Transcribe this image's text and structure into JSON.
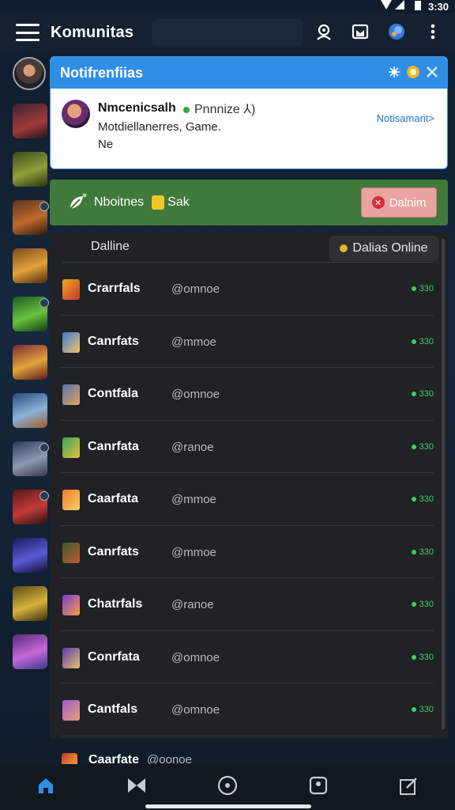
{
  "status_bar": {
    "time": "3:30"
  },
  "topbar": {
    "title": "Komunitas",
    "icons": [
      "menu-icon",
      "person-search-icon",
      "store-icon",
      "globe-icon",
      "more-vert-icon"
    ]
  },
  "notification": {
    "header_title": "Notifrenfiias",
    "sender_name": "Nmcenicsalh",
    "presence": "Pnnnize ⅄)",
    "line2": "Motdiellanerres, Game.",
    "line3": "Ne",
    "link": "Notisamarit>"
  },
  "friend_request": {
    "label": "Nboitnes",
    "label2": "Sak",
    "deny_label": "Dalnim"
  },
  "panel": {
    "title": "Dalline",
    "online_button": "Dalias Online"
  },
  "rows": [
    {
      "name": "Crarrfals",
      "handle": "@omnoe",
      "status": "330"
    },
    {
      "name": "Canrfats",
      "handle": "@mmoe",
      "status": "330"
    },
    {
      "name": "Contfala",
      "handle": "@omnoe",
      "status": "330"
    },
    {
      "name": "Canrfata",
      "handle": "@ranoe",
      "status": "330"
    },
    {
      "name": "Caarfata",
      "handle": "@mmoe",
      "status": "330"
    },
    {
      "name": "Canrfats",
      "handle": "@mmoe",
      "status": "330"
    },
    {
      "name": "Chatrfals",
      "handle": "@ranoe",
      "status": "330"
    },
    {
      "name": "Conrfata",
      "handle": "@omnoe",
      "status": "330"
    },
    {
      "name": "Cantfals",
      "handle": "@omnoe",
      "status": "330"
    }
  ],
  "partial_row": {
    "name": "Caarfate",
    "handle": "@oonoe"
  },
  "bottom_nav": [
    "home-icon",
    "swords-icon",
    "compass-icon",
    "store-icon",
    "edit-square-icon"
  ]
}
